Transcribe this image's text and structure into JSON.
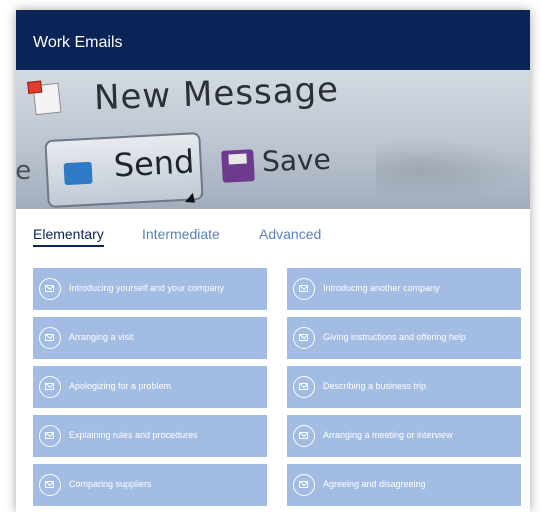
{
  "header": {
    "title": "Work Emails"
  },
  "hero": {
    "new_message": "New Message",
    "send": "Send",
    "save": "Save",
    "partial_text": "le"
  },
  "tabs": [
    {
      "label": "Elementary",
      "active": true
    },
    {
      "label": "Intermediate",
      "active": false
    },
    {
      "label": "Advanced",
      "active": false
    }
  ],
  "topics": [
    {
      "label": "Introducing yourself and your company",
      "icon": "mail-icon"
    },
    {
      "label": "Introducing another company",
      "icon": "mail-icon"
    },
    {
      "label": "Arranging a visit",
      "icon": "mail-icon"
    },
    {
      "label": "Giving instructions and offering help",
      "icon": "mail-icon"
    },
    {
      "label": "Apologizing for a problem",
      "icon": "mail-icon"
    },
    {
      "label": "Describing a business trip",
      "icon": "mail-icon"
    },
    {
      "label": "Explaining rules and procedures",
      "icon": "mail-icon"
    },
    {
      "label": "Arranging a meeting or interview",
      "icon": "mail-icon"
    },
    {
      "label": "Comparing suppliers",
      "icon": "mail-icon"
    },
    {
      "label": "Agreeing and disagreeing",
      "icon": "mail-icon"
    }
  ],
  "colors": {
    "header_bg": "#0a2458",
    "active_tab": "#0a2458",
    "inactive_tab": "#5a82b8",
    "topic_bg": "#a3bce4"
  }
}
